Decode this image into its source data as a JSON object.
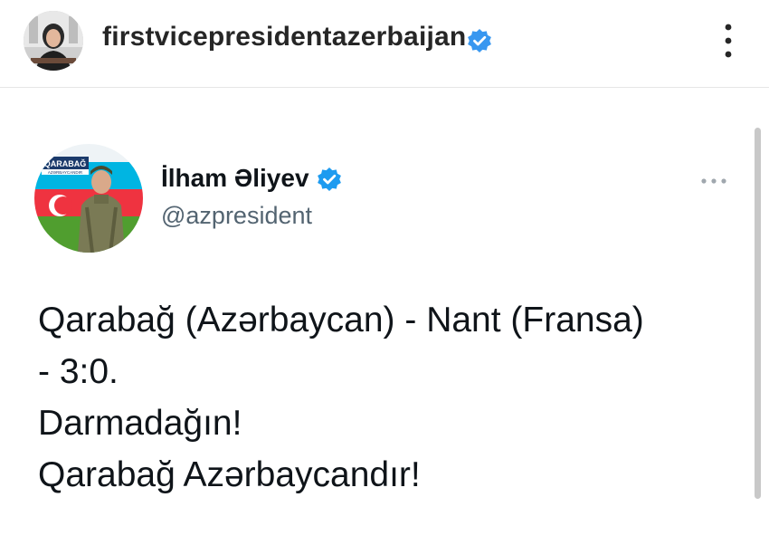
{
  "instagram_post": {
    "username": "firstvicepresidentazerbaijan",
    "avatar_icon": "profile-photo-icon",
    "verified_icon": "verified-badge-icon",
    "more_icon": "more-options-vertical-icon",
    "verified_color": "#3897f0"
  },
  "tweet": {
    "display_name": "İlham Əliyev",
    "handle": "@azpresident",
    "verified_icon": "verified-badge-icon",
    "verified_color": "#1d9bf0",
    "more_icon": "more-options-horizontal-icon",
    "avatar": {
      "icon": "profile-photo-icon",
      "banner_text": "QARABAĞ",
      "banner_subtext": "AZƏRBAYCANDIR",
      "flag_colors": [
        "#00b5e2",
        "#ef3340",
        "#509e2f"
      ]
    },
    "text_lines": [
      "Qarabağ (Azərbaycan) - Nant (Fransa)",
      "- 3:0.",
      "Darmadağın!",
      "Qarabağ Azərbaycandır!"
    ]
  }
}
